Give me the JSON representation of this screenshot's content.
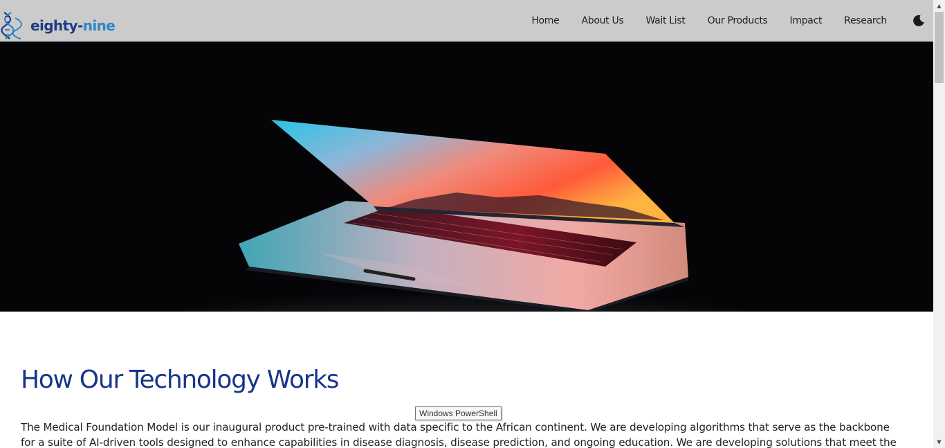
{
  "brand": {
    "name_part1": "eighty-",
    "name_part2": "nine",
    "logo_icon": "dna-helix-icon"
  },
  "nav": {
    "items": [
      {
        "label": "Home"
      },
      {
        "label": "About Us"
      },
      {
        "label": "Wait List"
      },
      {
        "label": "Our Products"
      },
      {
        "label": "Impact"
      },
      {
        "label": "Research"
      }
    ],
    "theme_toggle_icon": "moon-icon"
  },
  "hero": {
    "image": "laptop-glowing-screen-in-dark"
  },
  "section": {
    "title": "How Our Technology Works",
    "body": "The Medical Foundation Model is our inaugural product pre-trained with data specific to the African continent. We are developing algorithms that serve as the backbone for a suite of AI-driven tools designed to enhance capabilities in disease diagnosis, disease prediction, and ongoing education. We are developing solutions that meet the unique"
  },
  "tooltip": {
    "text": "Windows PowerShell"
  },
  "colors": {
    "navbar_bg": "#cbcbcb",
    "brand_dark": "#1c3a86",
    "brand_light": "#2e86c8",
    "heading": "#16358a",
    "hero_bg": "#050507"
  }
}
